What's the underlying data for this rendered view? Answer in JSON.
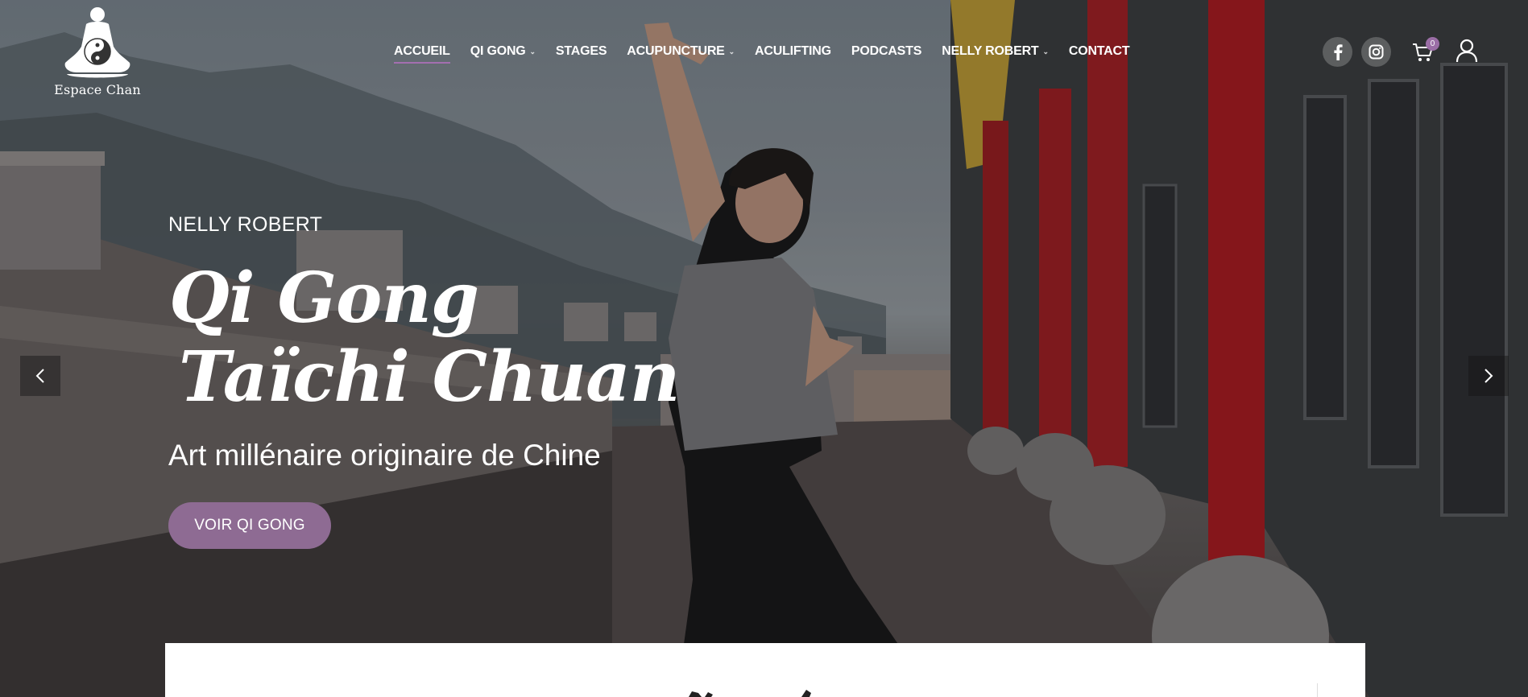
{
  "header": {
    "logo_text": "Espace Chan",
    "nav": [
      {
        "label": "ACCUEIL",
        "active": true,
        "has_dropdown": false
      },
      {
        "label": "QI GONG",
        "active": false,
        "has_dropdown": true
      },
      {
        "label": "STAGES",
        "active": false,
        "has_dropdown": false
      },
      {
        "label": "ACUPUNCTURE",
        "active": false,
        "has_dropdown": true
      },
      {
        "label": "ACULIFTING",
        "active": false,
        "has_dropdown": false
      },
      {
        "label": "PODCASTS",
        "active": false,
        "has_dropdown": false
      },
      {
        "label": "NELLY ROBERT",
        "active": false,
        "has_dropdown": true
      },
      {
        "label": "CONTACT",
        "active": false,
        "has_dropdown": false
      }
    ],
    "cart_count": "0",
    "icons": [
      "facebook-icon",
      "instagram-icon",
      "cart-icon",
      "user-icon"
    ]
  },
  "hero": {
    "subtitle": "NELLY ROBERT",
    "title_line1": "Qi Gong",
    "title_line2": "Taïchi Chuan",
    "tagline": "Art millénaire originaire de Chine",
    "cta_label": "VOIR QI GONG"
  },
  "colors": {
    "accent": "#8e6b93",
    "badge": "#9b6ea6",
    "pillar_red": "#b0171c"
  }
}
